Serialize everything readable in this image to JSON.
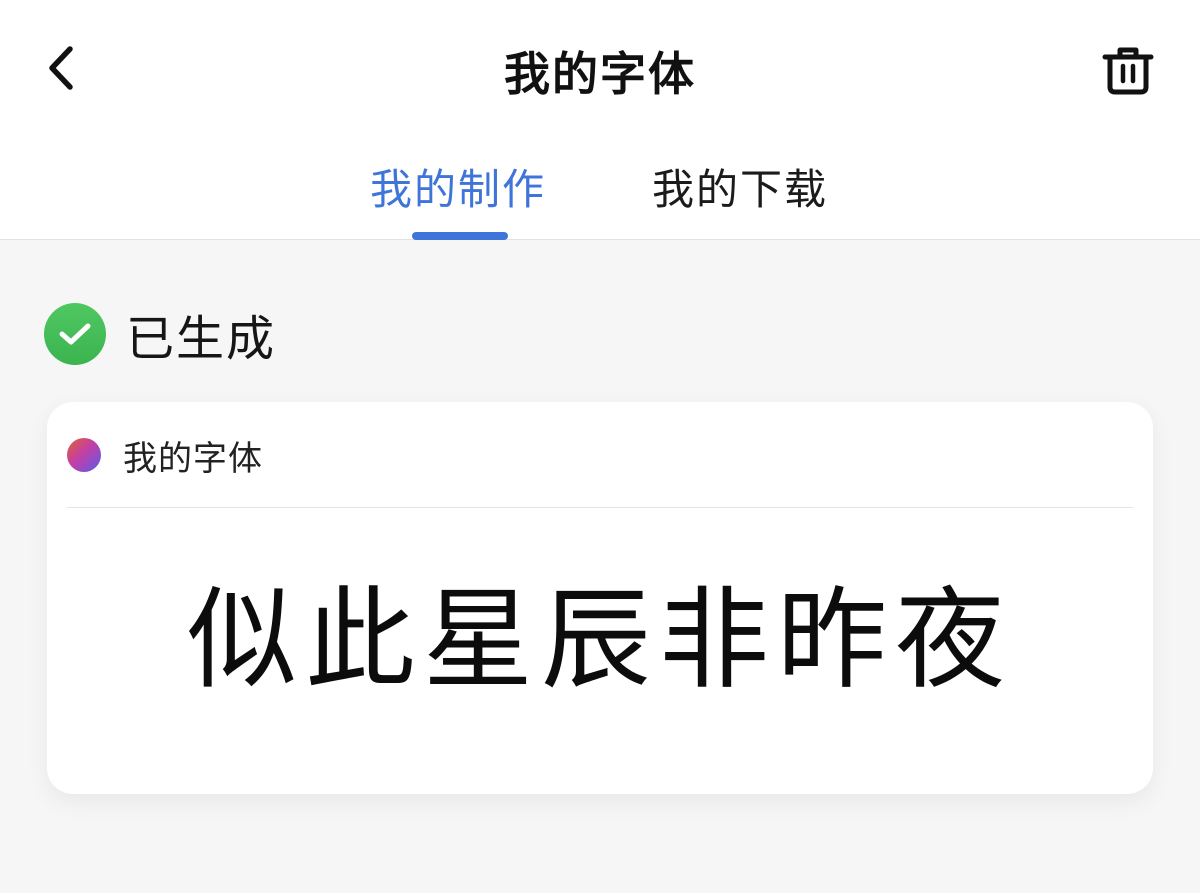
{
  "header": {
    "title": "我的字体",
    "back_icon": "chevron-left-icon",
    "trash_icon": "trash-icon"
  },
  "tabs": [
    {
      "label": "我的制作",
      "active": true
    },
    {
      "label": "我的下载",
      "active": false
    }
  ],
  "status": {
    "icon": "check-circle-icon",
    "label": "已生成",
    "color": "#44bd57"
  },
  "font_card": {
    "name": "我的字体",
    "preview_text": "似此星辰非昨夜"
  },
  "colors": {
    "accent": "#3f74d8",
    "success": "#44bd57",
    "background": "#f6f6f7"
  }
}
